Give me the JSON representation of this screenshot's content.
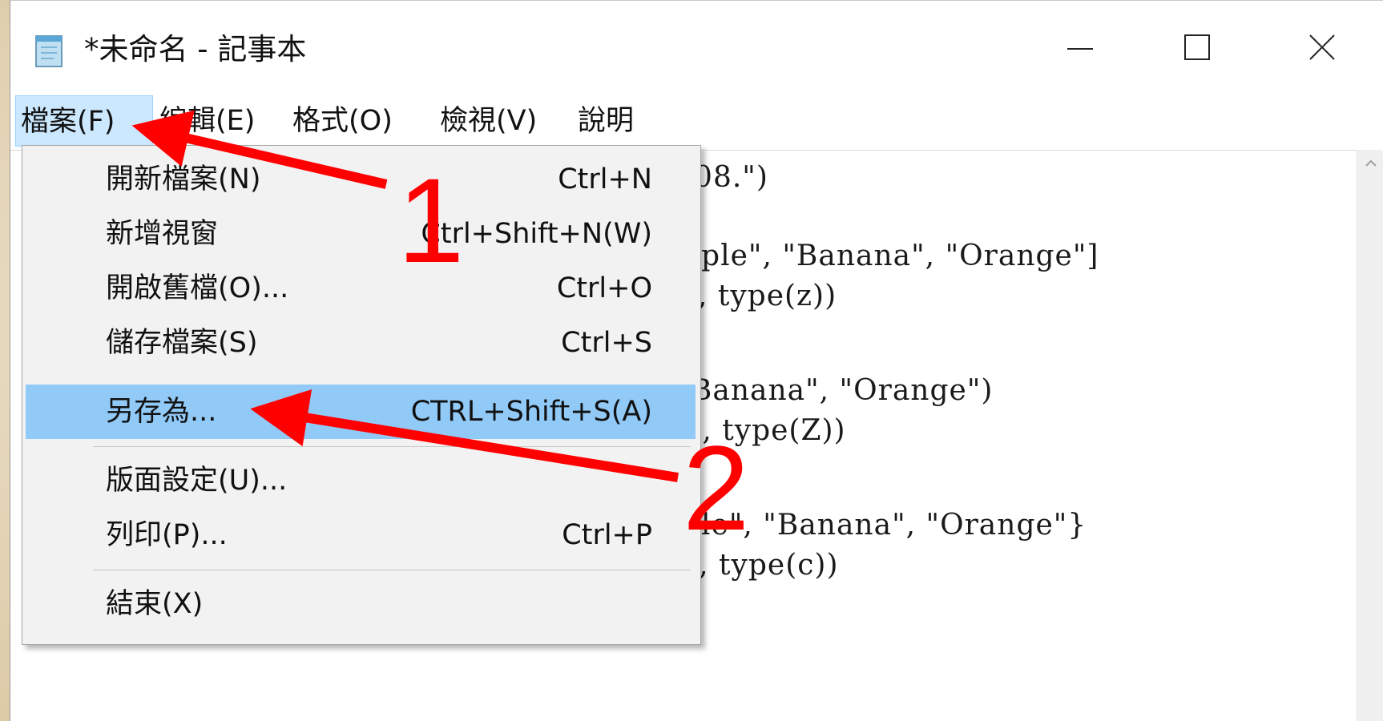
{
  "window": {
    "title": "*未命名 - 記事本",
    "minimize_glyph": "—",
    "maximize_glyph": "☐",
    "close_glyph": "✕"
  },
  "menubar": {
    "file": "檔案(F)",
    "edit": "編輯(E)",
    "format": "格式(O)",
    "view": "檢視(V)",
    "help": "說明"
  },
  "file_menu": {
    "items": [
      {
        "label": "開新檔案(N)",
        "shortcut": "Ctrl+N"
      },
      {
        "label": "新增視窗",
        "shortcut": "Ctrl+Shift+N(W)"
      },
      {
        "label": "開啟舊檔(O)...",
        "shortcut": "Ctrl+O"
      },
      {
        "label": "儲存檔案(S)",
        "shortcut": "Ctrl+S"
      },
      {
        "label": "另存為...",
        "shortcut": "CTRL+Shift+S(A)"
      },
      {
        "label": "版面設定(U)...",
        "shortcut": ""
      },
      {
        "label": "列印(P)...",
        "shortcut": "Ctrl+P"
      },
      {
        "label": "結束(X)",
        "shortcut": ""
      }
    ],
    "highlighted_index": 4
  },
  "editor": {
    "visible_lines": [
      ")08.\")",
      "pple\", \"Banana\", \"Orange\"]",
      "z, type(z))",
      "'Banana\", \"Orange\")",
      "Z, type(Z))",
      "ple\", \"Banana\", \"Orange\"}",
      "c, type(c))"
    ]
  },
  "annotations": {
    "step1": "1",
    "step2": "2",
    "arrow_color": "#ff0000"
  },
  "colors": {
    "menu_active_bg": "#cce8ff",
    "dropdown_highlight": "#91c9f7",
    "dropdown_bg": "#f2f2f2"
  }
}
